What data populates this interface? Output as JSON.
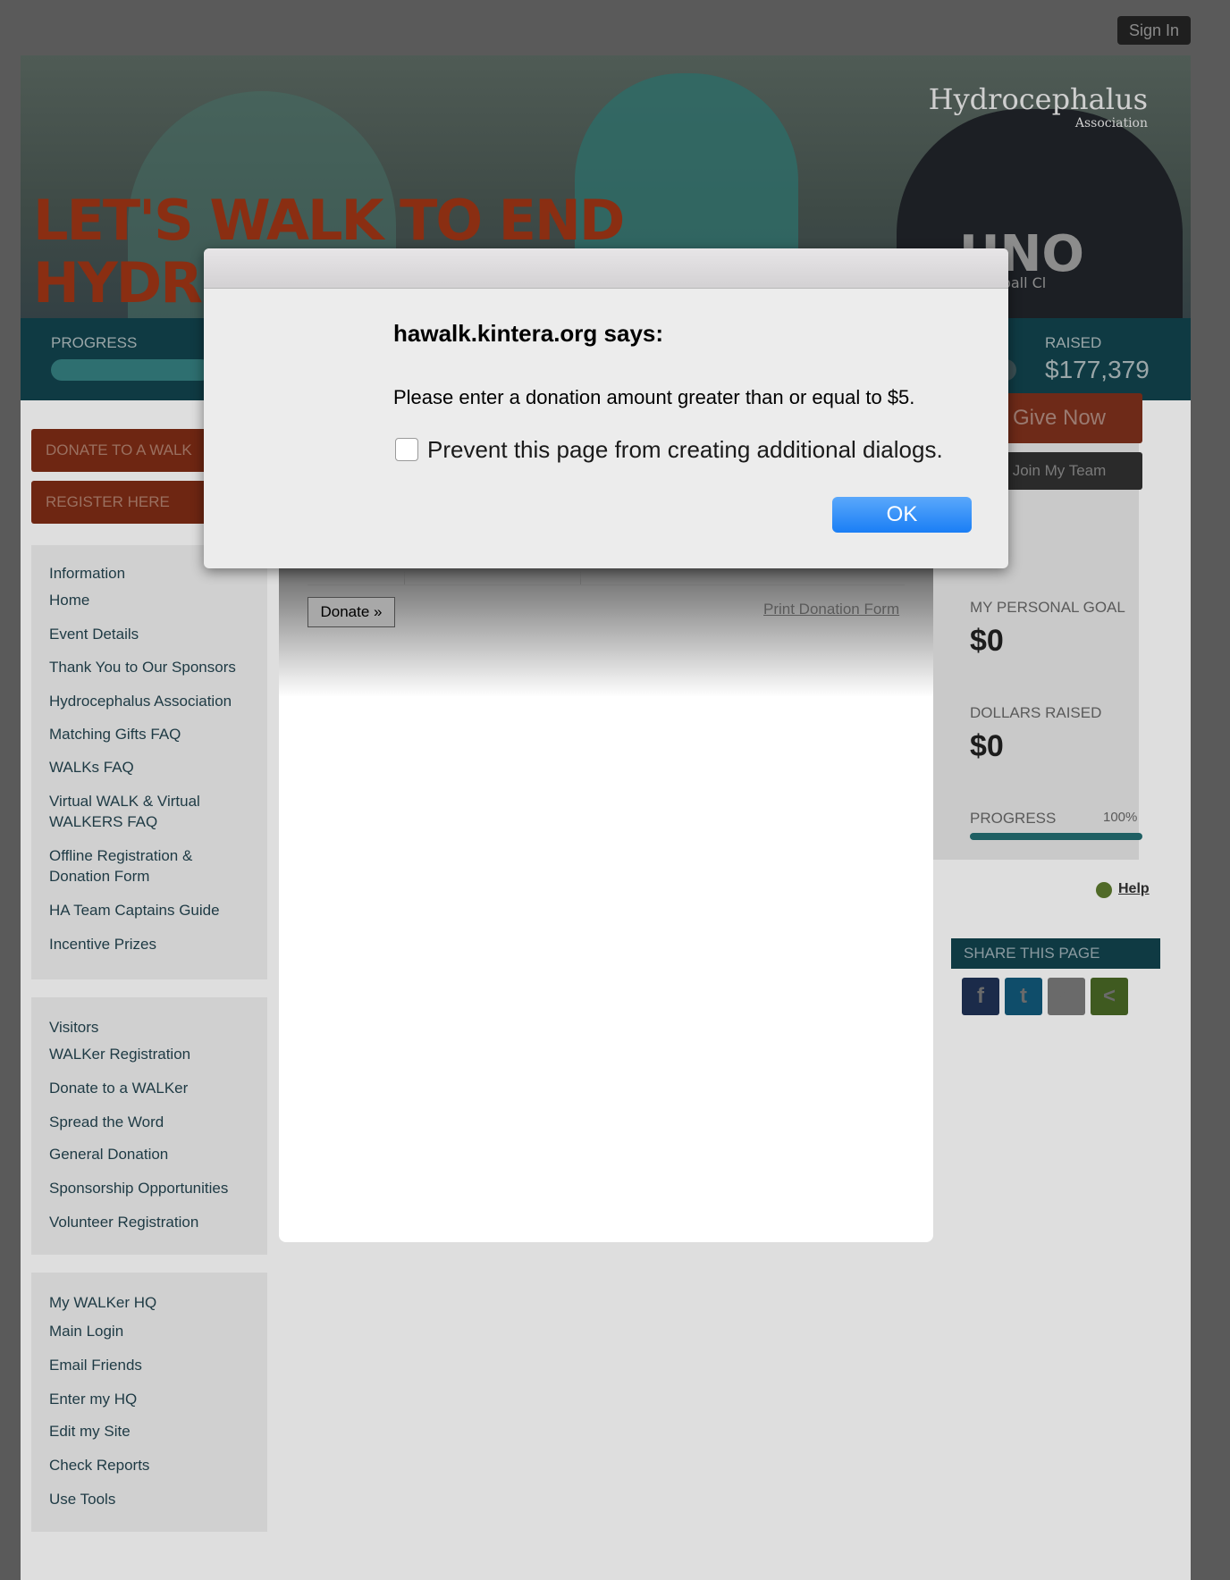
{
  "header": {
    "signin_label": "Sign In"
  },
  "hero": {
    "headline_line1": "LET'S WALK TO END",
    "headline_line2": "HYDR",
    "logo_main": "Hydrocephalus",
    "logo_sub": "Association",
    "shirt_text": "UNO",
    "shirt_sub": "Volleyball Cl"
  },
  "progress_bar": {
    "progress_label": "PROGRESS",
    "raised_label": "RAISED",
    "raised_value": "$177,379"
  },
  "left_buttons": {
    "donate_label": "DONATE TO A WALK",
    "register_label": "REGISTER HERE"
  },
  "menus": {
    "information": {
      "heading": "Information",
      "items": [
        "Home",
        "Event Details",
        "Thank You to Our Sponsors",
        "Hydrocephalus Association",
        "Matching Gifts FAQ",
        "WALKs FAQ",
        "Virtual WALK & Virtual WALKERS FAQ",
        "Offline Registration & Donation Form",
        "HA Team Captains Guide",
        "Incentive Prizes"
      ]
    },
    "visitors": {
      "heading": "Visitors",
      "items": [
        "WALKer Registration",
        "Donate to a WALKer",
        "Spread the Word",
        "General Donation",
        "Sponsorship Opportunities",
        "Volunteer Registration"
      ]
    },
    "hq": {
      "heading": "My WALKer HQ",
      "items": [
        "Main Login",
        "Email Friends",
        "Enter my HQ",
        "Edit my Site",
        "Check Reports",
        "Use Tools"
      ]
    }
  },
  "right_panel": {
    "give_now_label": "Give Now",
    "join_team_label": "Join My Team",
    "personal_goal_label": "MY PERSONAL GOAL",
    "personal_goal_value": "$0",
    "dollars_raised_label": "DOLLARS RAISED",
    "dollars_raised_value": "$0",
    "progress_label": "PROGRESS",
    "progress_percent": "100%",
    "help_label": "Help",
    "share_heading": "SHARE THIS PAGE",
    "share_icons": [
      "facebook-icon",
      "twitter-icon",
      "email-icon",
      "share-icon"
    ]
  },
  "form": {
    "donate_button": "Donate »",
    "print_link": "Print Donation Form"
  },
  "dialog": {
    "title": "hawalk.kintera.org says:",
    "message": "Please enter a donation amount greater than or equal to $5.",
    "checkbox_label": "Prevent this page from creating additional dialogs.",
    "ok_label": "OK"
  },
  "colors": {
    "overlay": "#5a5a5a",
    "dialog_bg": "#ececec",
    "ok_button": "#1a7ef5",
    "header_bar": "#0f3a43"
  }
}
